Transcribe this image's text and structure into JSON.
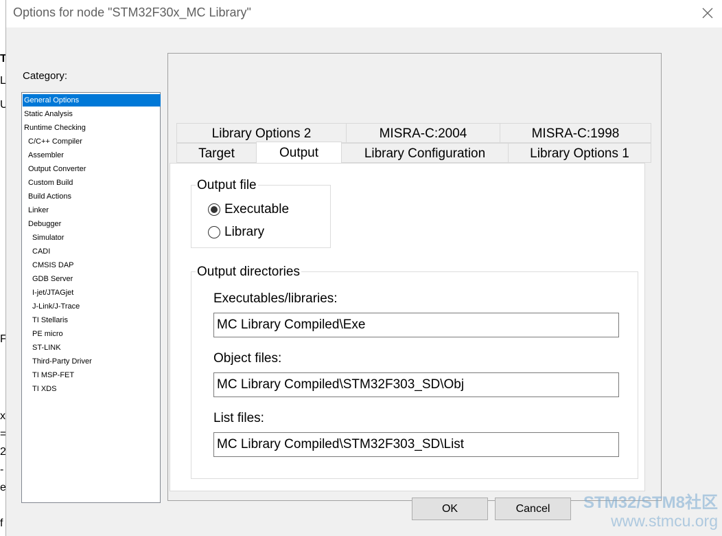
{
  "window": {
    "title": "Options for node \"STM32F30x_MC Library\""
  },
  "category": {
    "label": "Category:",
    "items": [
      {
        "label": "General Options",
        "selected": true
      },
      {
        "label": "Static Analysis"
      },
      {
        "label": "Runtime Checking"
      },
      {
        "label": "C/C++ Compiler"
      },
      {
        "label": "Assembler"
      },
      {
        "label": "Output Converter"
      },
      {
        "label": "Custom Build"
      },
      {
        "label": "Build Actions"
      },
      {
        "label": "Linker"
      },
      {
        "label": "Debugger"
      },
      {
        "label": "Simulator"
      },
      {
        "label": "CADI"
      },
      {
        "label": "CMSIS DAP"
      },
      {
        "label": "GDB Server"
      },
      {
        "label": "I-jet/JTAGjet"
      },
      {
        "label": "J-Link/J-Trace"
      },
      {
        "label": "TI Stellaris"
      },
      {
        "label": "PE micro"
      },
      {
        "label": "ST-LINK"
      },
      {
        "label": "Third-Party Driver"
      },
      {
        "label": "TI MSP-FET"
      },
      {
        "label": "TI XDS"
      }
    ]
  },
  "tabs": {
    "row1": [
      "Library Options 2",
      "MISRA-C:2004",
      "MISRA-C:1998"
    ],
    "row2": [
      "Target",
      "Output",
      "Library Configuration",
      "Library Options 1"
    ],
    "active": "Output"
  },
  "output_file": {
    "title": "Output file",
    "executable": "Executable",
    "library": "Library",
    "selected": "Executable"
  },
  "output_directories": {
    "title": "Output directories",
    "exe_label": "Executables/libraries:",
    "exe_value": "MC Library Compiled\\Exe",
    "obj_label": "Object files:",
    "obj_value": "MC Library Compiled\\STM32F303_SD\\Obj",
    "list_label": "List files:",
    "list_value": "MC Library Compiled\\STM32F303_SD\\List"
  },
  "buttons": {
    "ok": "OK",
    "cancel": "Cancel"
  },
  "watermark": {
    "line1": "STM32/STM8社区",
    "line2": "www.stmcu.org"
  },
  "background_app": {
    "chars": [
      "T",
      "L",
      "U",
      "F",
      "x",
      "=",
      "2",
      "-",
      "e",
      "f"
    ]
  }
}
